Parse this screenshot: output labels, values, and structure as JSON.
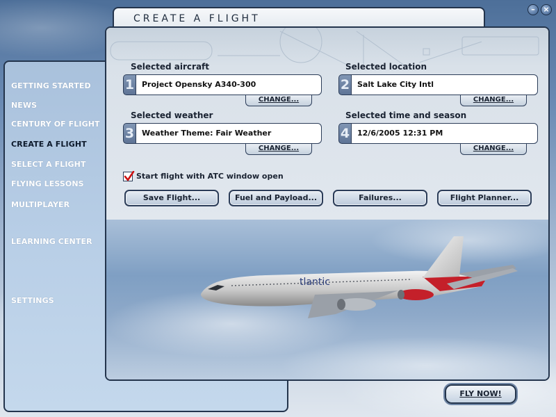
{
  "title": "CREATE A FLIGHT",
  "window_controls": {
    "minimize": "–",
    "close": "×"
  },
  "nav": {
    "items": [
      {
        "label": "GETTING STARTED",
        "active": false
      },
      {
        "label": "NEWS",
        "active": false
      },
      {
        "label": "CENTURY OF FLIGHT",
        "active": false
      },
      {
        "label": "CREATE A FLIGHT",
        "active": true
      },
      {
        "label": "SELECT A FLIGHT",
        "active": false
      },
      {
        "label": "FLYING LESSONS",
        "active": false
      },
      {
        "label": "MULTIPLAYER",
        "active": false
      },
      {
        "label": "LEARNING CENTER",
        "active": false
      },
      {
        "label": "SETTINGS",
        "active": false
      }
    ]
  },
  "sections": [
    {
      "number": "1",
      "label": "Selected aircraft",
      "value": "Project Opensky A340-300",
      "change": "CHANGE..."
    },
    {
      "number": "2",
      "label": "Selected location",
      "value": "Salt Lake City Intl",
      "change": "CHANGE..."
    },
    {
      "number": "3",
      "label": "Selected weather",
      "value": "Weather Theme: Fair Weather",
      "change": "CHANGE..."
    },
    {
      "number": "4",
      "label": "Selected time and season",
      "value": "12/6/2005 12:31 PM",
      "change": "CHANGE..."
    }
  ],
  "atc": {
    "label": "Start flight with ATC window open",
    "checked": true
  },
  "actions": [
    {
      "label": "Save Flight..."
    },
    {
      "label": "Fuel and Payload..."
    },
    {
      "label": "Failures..."
    },
    {
      "label": "Flight Planner..."
    }
  ],
  "aircraft_livery": "tlantic",
  "fly_now": "FLY NOW!",
  "colors": {
    "panel_border": "#23344c",
    "nav_bg": "#b9cfe7",
    "check_mark": "#cc1111",
    "livery_red": "#c4202a"
  }
}
